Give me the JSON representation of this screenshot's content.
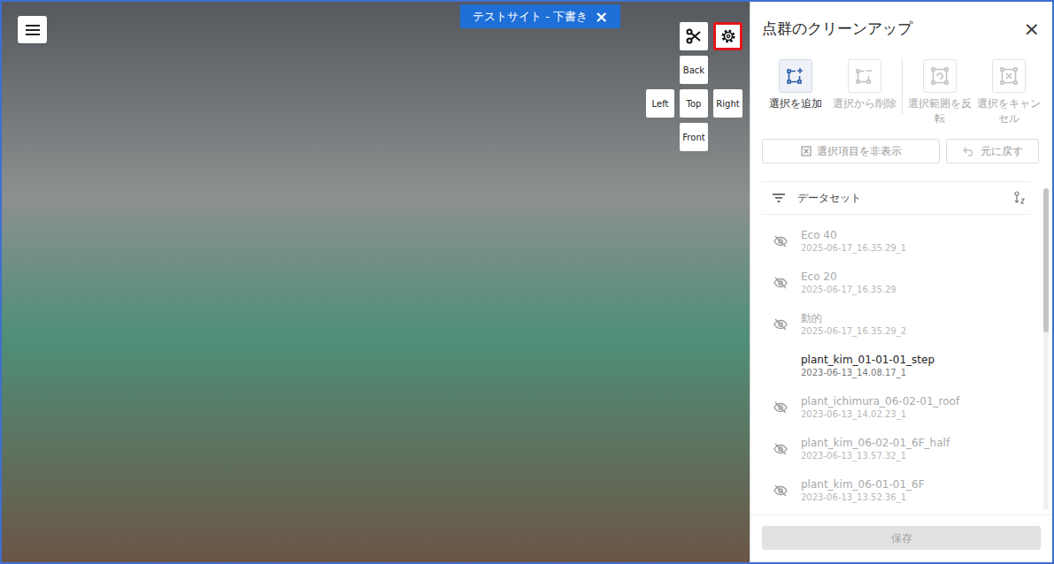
{
  "viewer": {
    "badge": {
      "label": "テストサイト - 下書き",
      "close": "×"
    },
    "tools": [
      {
        "kind": "scissors",
        "highlighted": false
      },
      {
        "kind": "settings",
        "highlighted": true
      }
    ],
    "view_buttons": [
      {
        "label": "Back"
      },
      {
        "label": "Left"
      },
      {
        "label": "Top"
      },
      {
        "label": "Right"
      },
      {
        "label": "Front"
      }
    ]
  },
  "panel": {
    "title": "点群のクリーンアップ",
    "close": "×",
    "tools": [
      {
        "label": "選択を追加",
        "kind": "add",
        "selected": true,
        "disabled": false
      },
      {
        "label": "選択から削除",
        "kind": "remove",
        "selected": false,
        "disabled": true
      },
      {
        "label": "選択範囲を反転",
        "kind": "invert",
        "selected": false,
        "disabled": true
      },
      {
        "label": "選択をキャンセル",
        "kind": "cancel",
        "selected": false,
        "disabled": true
      }
    ],
    "actions": [
      {
        "label": "選択項目を非表示",
        "kind": "hide",
        "disabled": true
      },
      {
        "label": "元に戻す",
        "kind": "undo",
        "disabled": true
      }
    ],
    "list_header": "データセット",
    "datasets": [
      {
        "name": "Eco 40",
        "date": "2025-06-17_16.35.29_1",
        "visible": false
      },
      {
        "name": "Eco 20",
        "date": "2025-06-17_16.35.29",
        "visible": false
      },
      {
        "name": "動的",
        "date": "2025-06-17_16.35.29_2",
        "visible": false
      },
      {
        "name": "plant_kim_01-01-01_step",
        "date": "2023-06-13_14.08.17_1",
        "visible": true
      },
      {
        "name": "plant_ichimura_06-02-01_roof",
        "date": "2023-06-13_14.02.23_1",
        "visible": false
      },
      {
        "name": "plant_kim_06-02-01_6F_half",
        "date": "2023-06-13_13.57.32_1",
        "visible": false
      },
      {
        "name": "plant_kim_06-01-01_6F",
        "date": "2023-06-13_13.52.36_1",
        "visible": false
      }
    ],
    "list_scroll": {
      "level": 0.45
    },
    "save": {
      "label": "保存",
      "disabled": true
    }
  }
}
